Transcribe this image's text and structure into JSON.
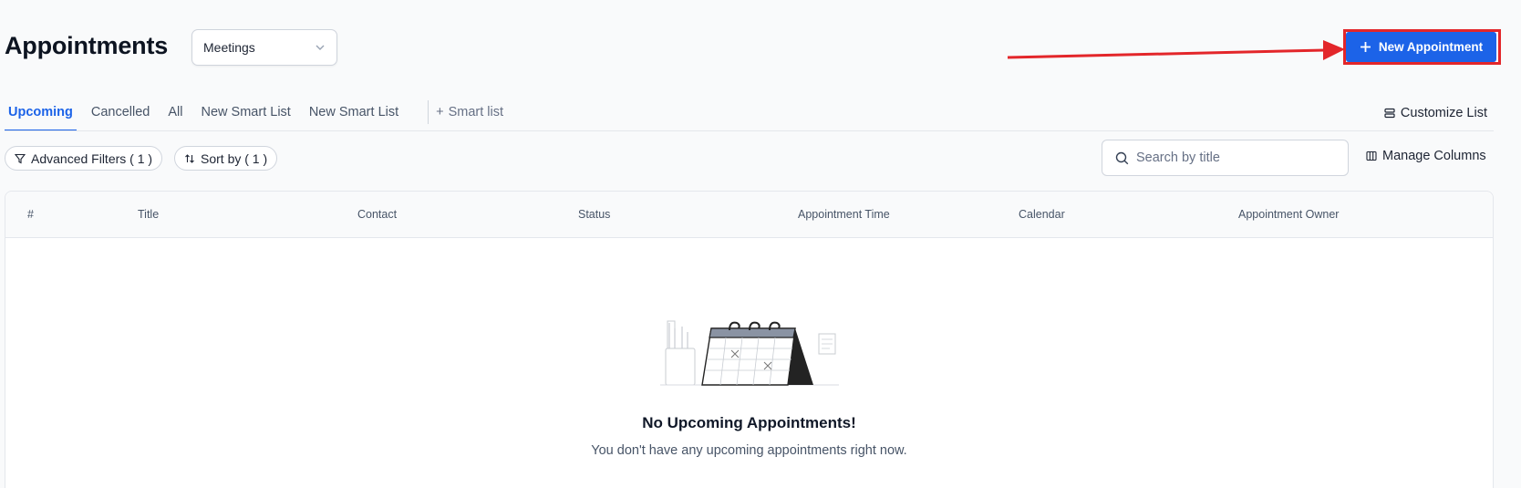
{
  "header": {
    "title": "Appointments",
    "view_select": "Meetings",
    "new_button_label": "New Appointment"
  },
  "annotation": {
    "highlight_color": "#e3262a"
  },
  "tabs": [
    {
      "label": "Upcoming",
      "active": true
    },
    {
      "label": "Cancelled",
      "active": false
    },
    {
      "label": "All",
      "active": false
    },
    {
      "label": "New Smart List",
      "active": false
    },
    {
      "label": "New Smart List",
      "active": false
    }
  ],
  "add_smart_list_label": "Smart list",
  "customize_list_label": "Customize List",
  "filters": {
    "advanced_filters_label": "Advanced Filters ( 1 )",
    "sort_by_label": "Sort by ( 1 )"
  },
  "search": {
    "placeholder": "Search by title",
    "value": ""
  },
  "manage_columns_label": "Manage Columns",
  "table": {
    "columns": [
      "#",
      "Title",
      "Contact",
      "Status",
      "Appointment Time",
      "Calendar",
      "Appointment Owner"
    ]
  },
  "empty_state": {
    "title": "No Upcoming Appointments!",
    "subtitle": "You don't have any upcoming appointments right now."
  },
  "colors": {
    "accent": "#1c63e8",
    "text": "#101828",
    "muted": "#475467"
  }
}
